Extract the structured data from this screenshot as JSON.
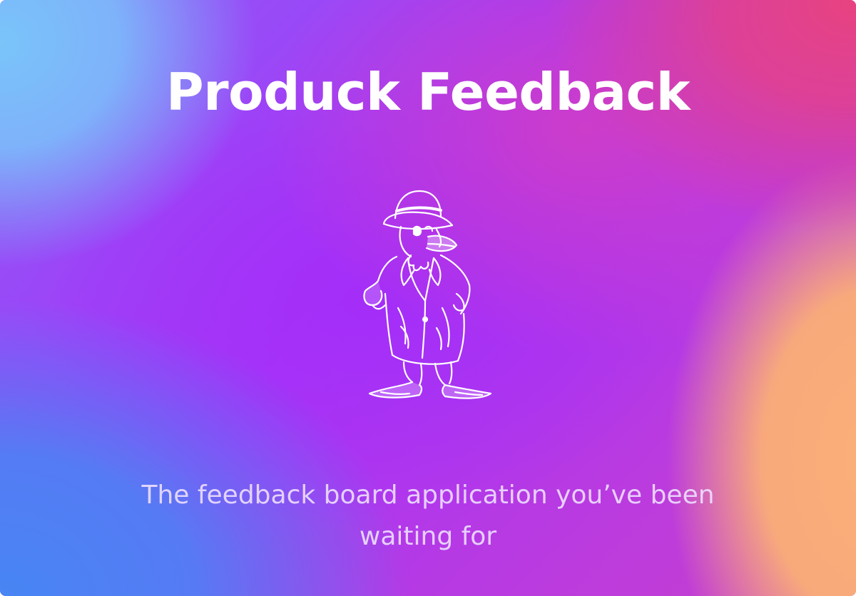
{
  "hero": {
    "title": "Produck Feedback",
    "tagline": "The feedback board application you’ve been waiting for",
    "mascot_icon": "duck-in-suit-and-hat-icon"
  },
  "colors": {
    "text_primary": "#ffffff",
    "text_tagline": "#ebdcff",
    "gradient_blue": "#7dc3f7",
    "gradient_pink": "#e2457f",
    "gradient_purple": "#a437f0",
    "gradient_orange": "#f8b07a",
    "gradient_deep_blue": "#4a86ee"
  }
}
